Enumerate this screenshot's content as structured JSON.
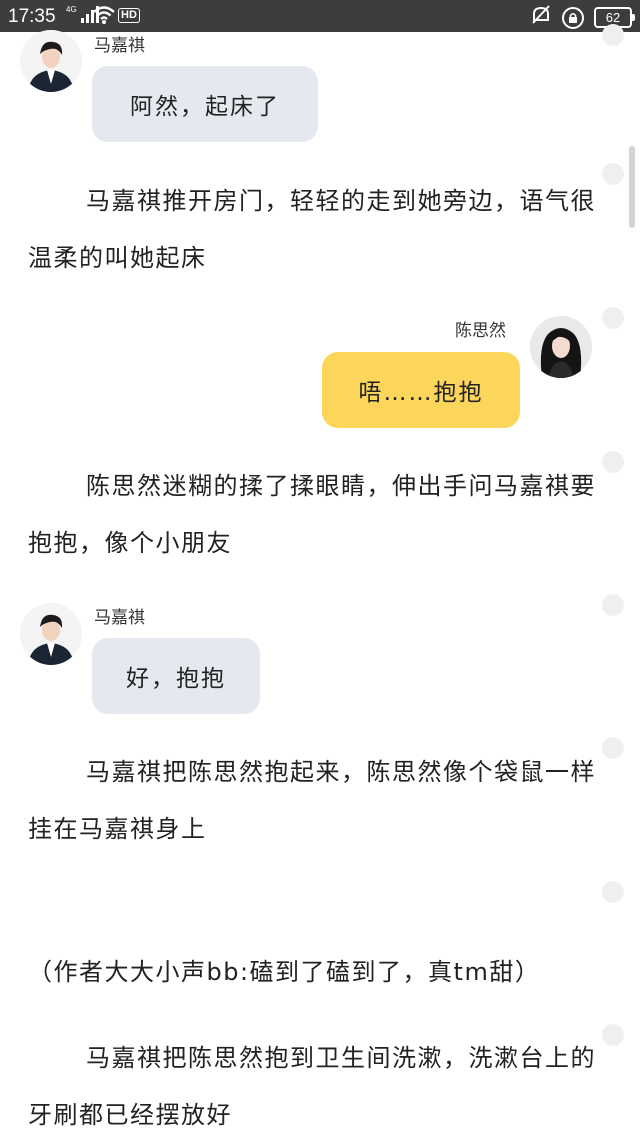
{
  "status_bar": {
    "time": "17:35",
    "network": "4G",
    "hd": "HD",
    "battery": "62"
  },
  "messages": [
    {
      "speaker": "马嘉祺",
      "text": "阿然，起床了"
    },
    {
      "speaker": "陈思然",
      "text": "唔……抱抱"
    },
    {
      "speaker": "马嘉祺",
      "text": "好，抱抱"
    }
  ],
  "paragraphs": [
    "马嘉祺推开房门，轻轻的走到她旁边，语气很温柔的叫她起床",
    "陈思然迷糊的揉了揉眼睛，伸出手问马嘉祺要抱抱，像个小朋友",
    "马嘉祺把陈思然抱起来，陈思然像个袋鼠一样挂在马嘉祺身上",
    "（作者大大小声bb:磕到了磕到了，真tm甜）",
    "马嘉祺把陈思然抱到卫生间洗漱，洗漱台上的牙刷都已经摆放好"
  ]
}
